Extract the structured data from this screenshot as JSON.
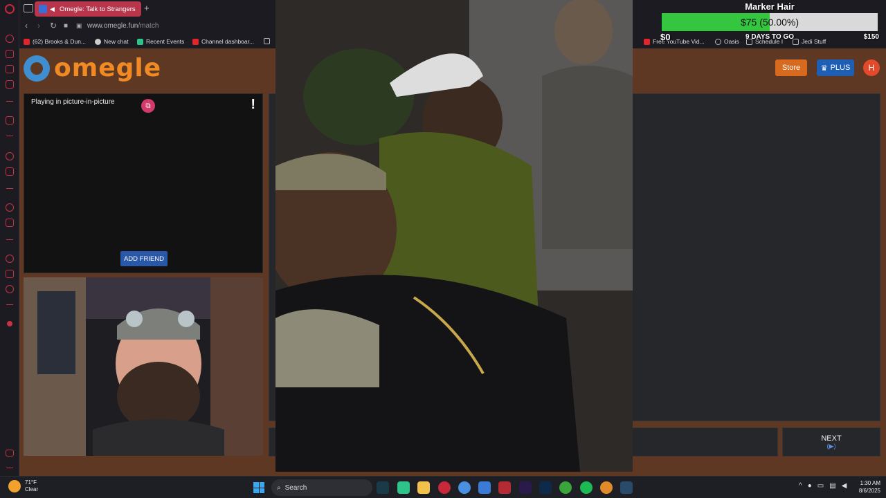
{
  "browser": {
    "tab_title": "Omegle: Talk to Strangers",
    "url_host": "www.omegle.fun",
    "url_path": "/match",
    "bookmarks": [
      {
        "label": "(62) Brooks & Dun..."
      },
      {
        "label": "New chat"
      },
      {
        "label": "Recent Events"
      },
      {
        "label": "Channel dashboar..."
      },
      {
        "label": "Free YouTube Vid..."
      },
      {
        "label": "Oasis"
      },
      {
        "label": "Schedule I"
      },
      {
        "label": "Jedi Stuff"
      }
    ]
  },
  "site": {
    "logo_text": "omegle",
    "store_label": "Store",
    "plus_label": "PLUS",
    "avatar_initial": "H"
  },
  "stranger_pane": {
    "pip_label": "Playing in picture-in-picture",
    "report_label": "!",
    "add_friend_label": "ADD FRIEND"
  },
  "controls": {
    "next_label": "NEXT",
    "next_hint": "(▶)"
  },
  "goal": {
    "title": "Marker Hair",
    "bar_text": "$75 (50.00%)",
    "progress": 0.5,
    "min_label": "$0",
    "days_label": "9 DAYS TO GO",
    "max_label": "$150"
  },
  "taskbar": {
    "temperature": "71°F",
    "condition": "Clear",
    "search_placeholder": "Search",
    "time": "1:30 AM",
    "date": "8/6/2025"
  },
  "colors": {
    "page_bg": "#5e3822",
    "accent_orange": "#f08a24",
    "goal_fill": "#35c640",
    "tab_active": "#b8364b"
  }
}
